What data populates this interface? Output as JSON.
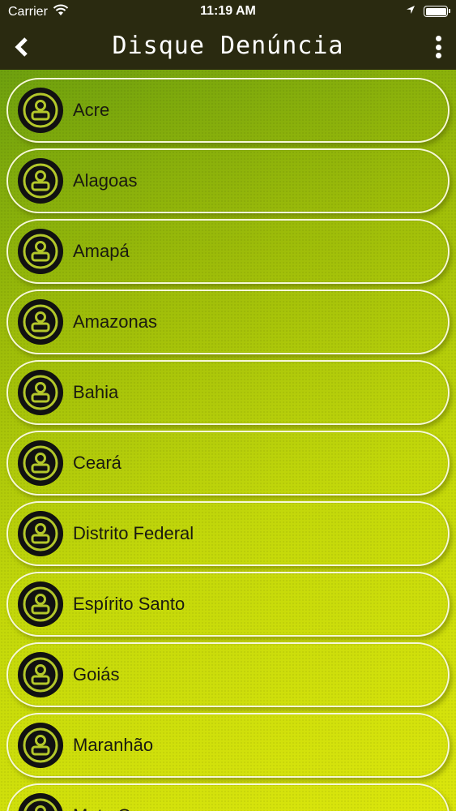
{
  "status_bar": {
    "carrier": "Carrier",
    "time": "11:19 AM"
  },
  "nav": {
    "title": "Disque Denúncia"
  },
  "colors": {
    "accent_icon_ring": "#b3c72a",
    "bar_background": "#2a2a10"
  },
  "states": [
    {
      "label": "Acre"
    },
    {
      "label": "Alagoas"
    },
    {
      "label": "Amapá"
    },
    {
      "label": "Amazonas"
    },
    {
      "label": "Bahia"
    },
    {
      "label": "Ceará"
    },
    {
      "label": "Distrito Federal"
    },
    {
      "label": "Espírito Santo"
    },
    {
      "label": "Goiás"
    },
    {
      "label": "Maranhão"
    },
    {
      "label": "Mato Grosso"
    }
  ]
}
